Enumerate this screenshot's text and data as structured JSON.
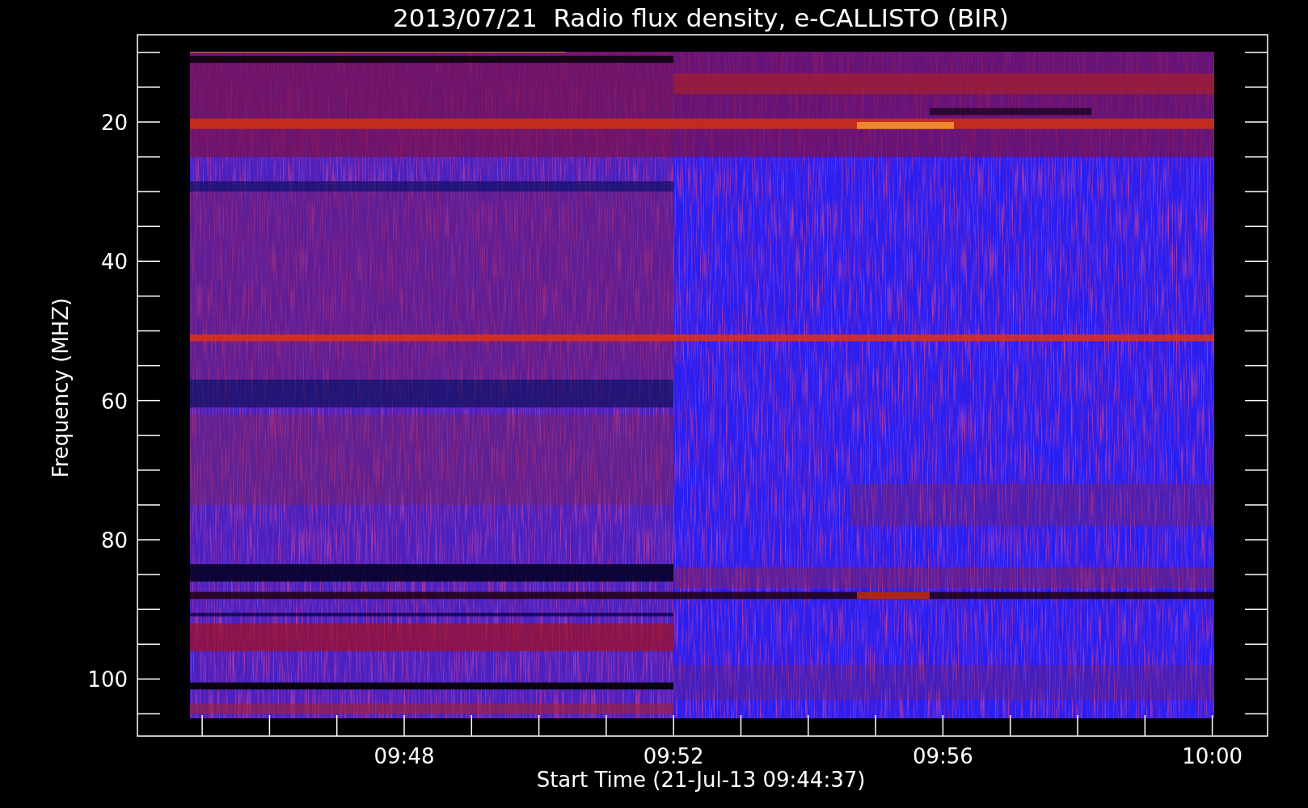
{
  "title": "2013/07/21  Radio flux density, e-CALLISTO (BIR)",
  "y_axis": {
    "label": "Frequency (MHZ)",
    "ticks": [
      "20",
      "40",
      "60",
      "80",
      "100"
    ]
  },
  "x_axis": {
    "label": "Start Time (21-Jul-13 09:44:37)",
    "ticks": [
      "09:48",
      "09:52",
      "09:56",
      "10:00"
    ]
  }
}
